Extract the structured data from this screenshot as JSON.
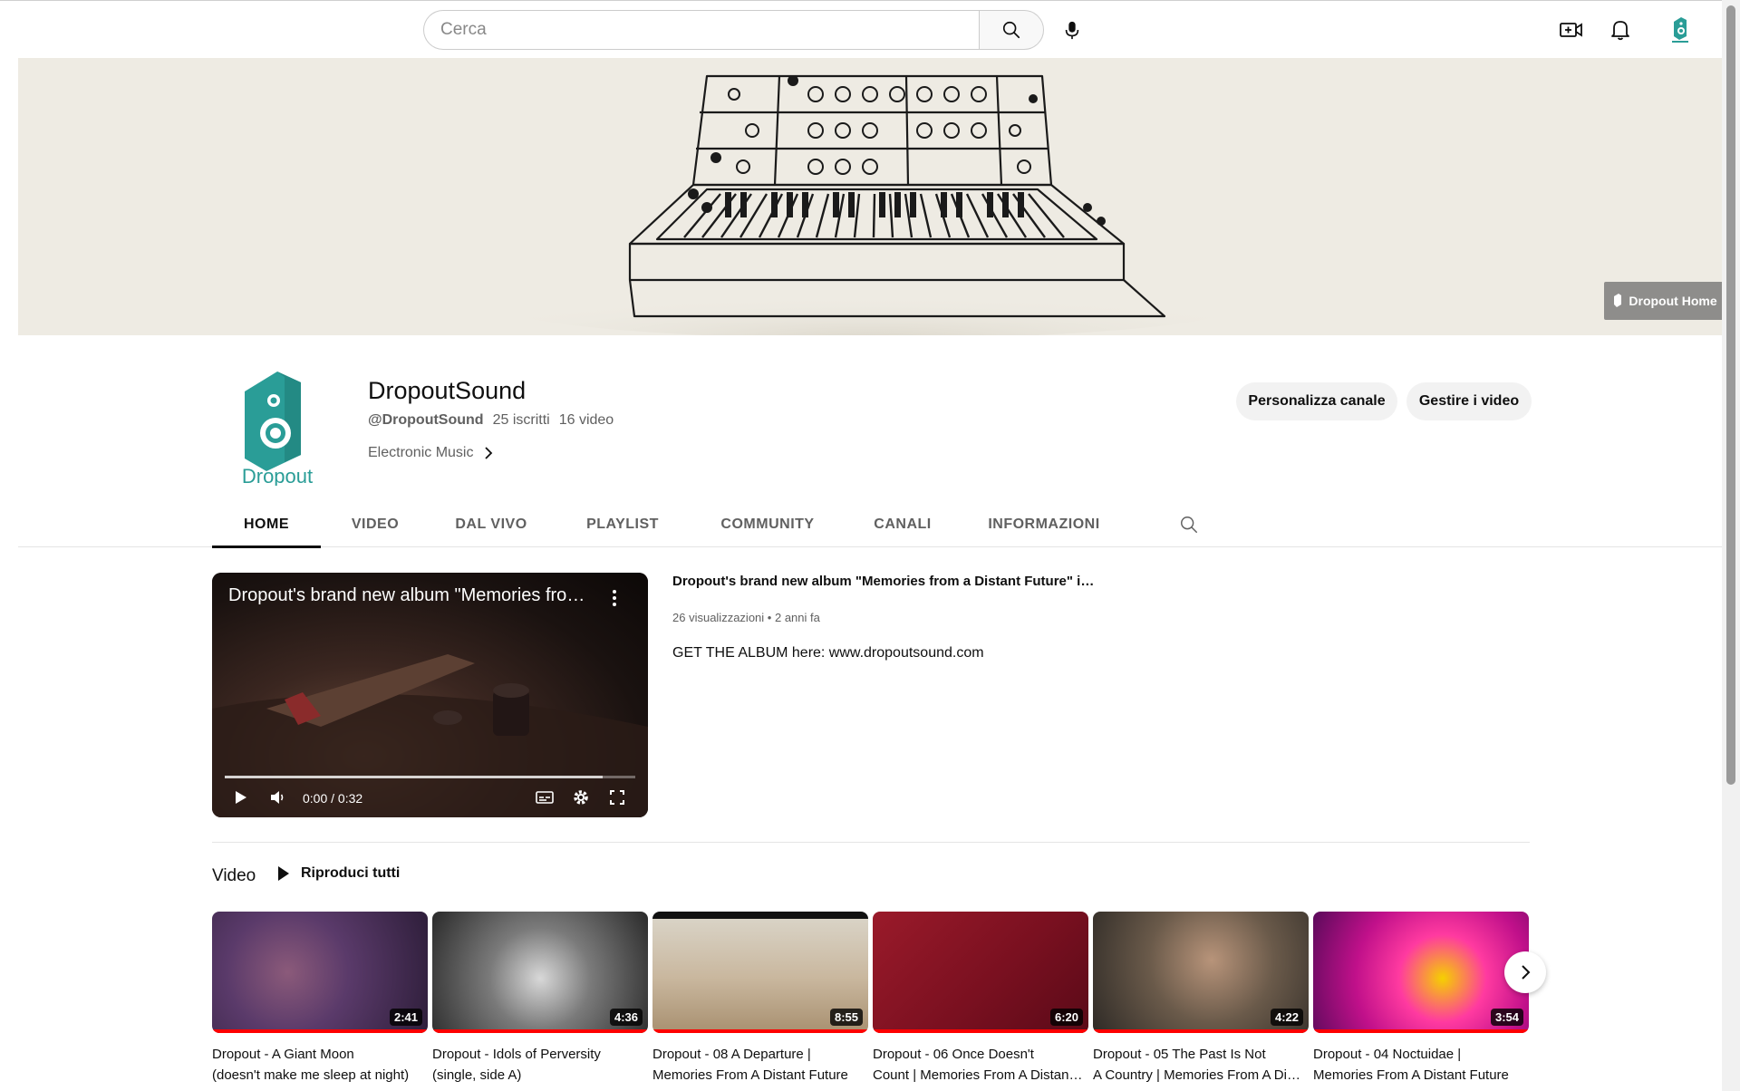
{
  "search": {
    "placeholder": "Cerca"
  },
  "topbar": {
    "icons": [
      "search-icon",
      "microphone-icon",
      "create-video-icon",
      "bell-icon",
      "avatar"
    ]
  },
  "banner": {
    "link_label": "Dropout Home"
  },
  "channel": {
    "name": "DropoutSound",
    "handle": "@DropoutSound",
    "subscribers": "25 iscritti",
    "video_count": "16 video",
    "description": "Electronic Music",
    "logo_text": "Dropout",
    "customize_label": "Personalizza canale",
    "manage_label": "Gestire i video"
  },
  "tabs": [
    {
      "label": "HOME"
    },
    {
      "label": "VIDEO"
    },
    {
      "label": "DAL VIVO"
    },
    {
      "label": "PLAYLIST"
    },
    {
      "label": "COMMUNITY"
    },
    {
      "label": "CANALI"
    },
    {
      "label": "INFORMAZIONI"
    }
  ],
  "featured": {
    "overlay_title": "Dropout's brand new album \"Memories from a Distant Future\"",
    "title": "Dropout's brand new album \"Memories from a Distant Future\" is out now",
    "views": "26 visualizzazioni",
    "separator": "•",
    "age": "2 anni fa",
    "description": "GET THE ALBUM here: www.dropoutsound.com",
    "time": "0:00 / 0:32",
    "progress": 0.92
  },
  "shelf": {
    "title": "Video",
    "play_all": "Riproduci tutti",
    "videos": [
      {
        "line1": "Dropout - A Giant Moon",
        "line2": "(doesn't make me sleep at night)",
        "duration": "2:41"
      },
      {
        "line1": "Dropout - Idols of Perversity",
        "line2": "(single, side A)",
        "duration": "4:36"
      },
      {
        "line1": "Dropout - 08 A Departure |",
        "line2": "Memories From A Distant Future",
        "duration": "8:55"
      },
      {
        "line1": "Dropout - 06 Once Doesn't",
        "line2": "Count | Memories From A Distant Future",
        "duration": "6:20"
      },
      {
        "line1": "Dropout - 05 The Past Is Not",
        "line2": "A Country | Memories From A Distant Future",
        "duration": "4:22"
      },
      {
        "line1": "Dropout - 04 Noctuidae |",
        "line2": "Memories From A Distant Future",
        "duration": "3:54"
      }
    ]
  },
  "colors": {
    "brand_teal": "#2a9d97",
    "progress_red": "#ff0000"
  }
}
